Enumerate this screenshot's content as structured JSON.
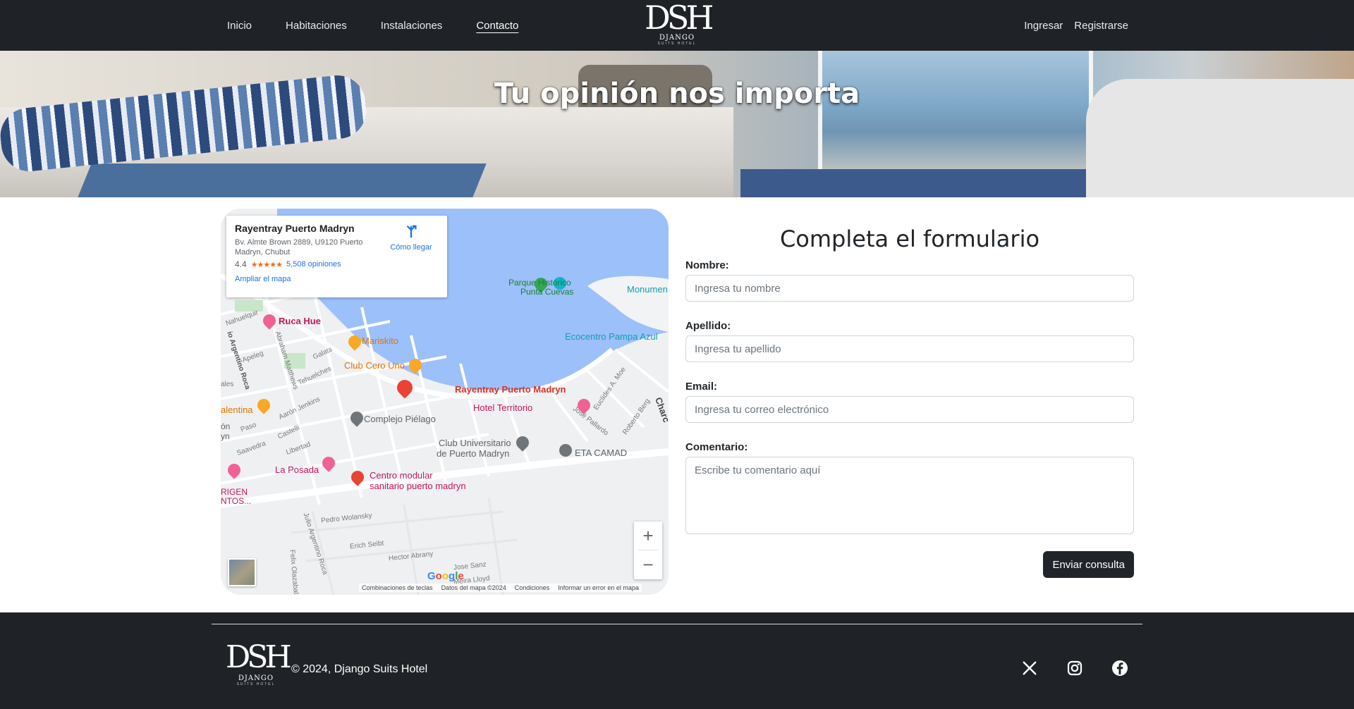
{
  "nav": {
    "links": [
      "Inicio",
      "Habitaciones",
      "Instalaciones",
      "Contacto"
    ],
    "login": "Ingresar",
    "register": "Registrarse"
  },
  "logo": {
    "mark": "DSH",
    "name": "DJANGO",
    "sub": "SUITS HOTEL"
  },
  "hero": {
    "title": "Tu opinión nos importa"
  },
  "map": {
    "card": {
      "title": "Rayentray Puerto Madryn",
      "address": "Bv. Almte Brown 2889, U9120 Puerto Madryn, Chubut",
      "rating": "4.4",
      "stars": "★★★★★",
      "reviews": "5,508 opiniones",
      "enlarge": "Ampliar el mapa",
      "directions": "Cómo llegar"
    },
    "places": {
      "rayentray": "Rayentray Puerto Madryn",
      "hotel_territorio": "Hotel Territorio",
      "ruca_hue": "Ruca Hue",
      "mariskito": "Mariskito",
      "club_cero_uno": "Club Cero Uno",
      "parque": "Parque Histórico",
      "parque2": "Punta Cuevas",
      "monumento": "Monumen",
      "ecocentro": "Ecocentro Pampa Azul",
      "complejo": "Complejo Piélago",
      "club_univ": "Club Universitario",
      "club_univ2": "de Puerto Madryn",
      "eta": "ETA CAMAD",
      "la_posada": "La Posada",
      "centro_modular": "Centro modular",
      "centro_modular2": "sanitario puerto madryn",
      "valentina": "alentina",
      "origen": "RIGEN",
      "origen2": "NTOS...",
      "on": "ón",
      "yn": "yn",
      "charc": "Charc"
    },
    "streets": {
      "nahuelquir": "Nahuelquir",
      "apeleg": "Apeleg",
      "galats": "Galats",
      "tehuelches": "Tehuelches",
      "abraham": "Abraham Matthews",
      "jenkins": "Aarón Jenkins",
      "paso": "Paso",
      "castelli": "Castelli",
      "saavedra": "Saavedra",
      "libertad": "Libertad",
      "roca": "Julio Argentino Roca",
      "roca_short": "io Argentino Roca",
      "wolansky": "Pedro Wolansky",
      "seibt": "Erich Seibt",
      "abrany": "Hector Abrany",
      "sanz": "Jose Sanz",
      "lloyd": "Meira Lloyd",
      "olazabal": "Felix Olazabal",
      "pallardo": "José Pallardo",
      "berg": "Roberto Berg",
      "moe": "Euclides A. Moe",
      "ales": "ales"
    },
    "google": "Google",
    "footer": [
      "Combinaciones de teclas",
      "Datos del mapa ©2024",
      "Condiciones",
      "Informar un error en el mapa"
    ],
    "zoom_in": "+",
    "zoom_out": "−"
  },
  "form": {
    "title": "Completa el formulario",
    "nombre_label": "Nombre:",
    "nombre_placeholder": "Ingresa tu nombre",
    "apellido_label": "Apellido:",
    "apellido_placeholder": "Ingresa tu apellido",
    "email_label": "Email:",
    "email_placeholder": "Ingresa tu correo electrónico",
    "comentario_label": "Comentario:",
    "comentario_placeholder": "Escribe tu comentario aquí",
    "submit": "Enviar consulta"
  },
  "footer": {
    "copyright": "© 2024, Django Suits Hotel",
    "social_icons": [
      "x-icon",
      "instagram-icon",
      "facebook-icon"
    ]
  }
}
